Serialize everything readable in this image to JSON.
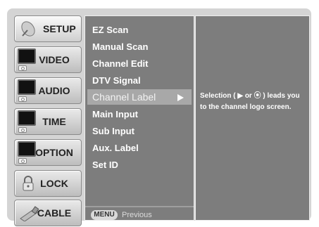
{
  "tabs": [
    {
      "label": "SETUP",
      "icon": "satellite-dish-icon"
    },
    {
      "label": "VIDEO",
      "icon": "tv-icon"
    },
    {
      "label": "AUDIO",
      "icon": "tv-icon"
    },
    {
      "label": "TIME",
      "icon": "tv-icon"
    },
    {
      "label": "OPTION",
      "icon": "tv-icon"
    },
    {
      "label": "LOCK",
      "icon": "padlock-icon"
    },
    {
      "label": "CABLE",
      "icon": "cable-plug-icon"
    }
  ],
  "menu": {
    "items": [
      "EZ Scan",
      "Manual  Scan",
      "Channel Edit",
      "DTV Signal",
      "Channel Label",
      "Main Input",
      "Sub Input",
      "Aux. Label",
      "Set ID"
    ],
    "selected_index": 4
  },
  "footer": {
    "menu_button": "MENU",
    "previous": "Previous"
  },
  "help": {
    "text": "Selection ( ▶ or ⦿ ) leads you to the channel logo screen."
  },
  "colors": {
    "panel": "#7d7d7d",
    "highlight": "#a8a8a8",
    "frame": "#d4d4d4"
  }
}
